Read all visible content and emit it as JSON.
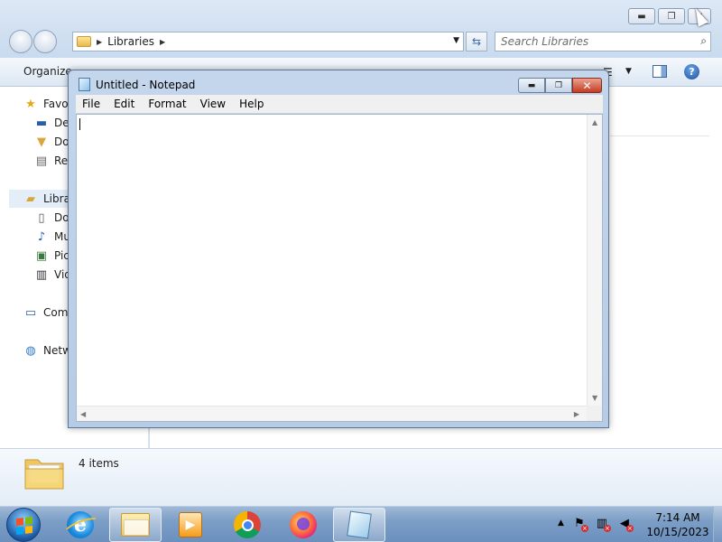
{
  "explorer": {
    "breadcrumb": {
      "items": [
        "Libraries"
      ]
    },
    "search": {
      "placeholder": "Search Libraries"
    },
    "toolbar": {
      "organize_label": "Organize"
    },
    "nav": {
      "favorites": {
        "label": "Favo",
        "icon": "star-icon",
        "children": [
          {
            "label": "Des",
            "icon": "desktop-icon"
          },
          {
            "label": "Dov",
            "icon": "downloads-icon"
          },
          {
            "label": "Rec",
            "icon": "recent-places-icon"
          }
        ]
      },
      "libraries": {
        "label": "Libra",
        "icon": "libraries-icon",
        "children": [
          {
            "label": "Do",
            "icon": "documents-icon"
          },
          {
            "label": "Mu",
            "icon": "music-icon"
          },
          {
            "label": "Pic",
            "icon": "pictures-icon"
          },
          {
            "label": "Vid",
            "icon": "videos-icon"
          }
        ]
      },
      "computer": {
        "label": "Com",
        "icon": "computer-icon"
      },
      "network": {
        "label": "Netw",
        "icon": "network-icon"
      }
    },
    "details": {
      "count_label": "4 items"
    }
  },
  "notepad": {
    "title": "Untitled - Notepad",
    "menu": [
      "File",
      "Edit",
      "Format",
      "View",
      "Help"
    ],
    "content": ""
  },
  "taskbar": {
    "apps": [
      {
        "name": "internet-explorer",
        "active": false
      },
      {
        "name": "windows-explorer",
        "active": true
      },
      {
        "name": "windows-media-player",
        "active": false
      },
      {
        "name": "google-chrome",
        "active": false
      },
      {
        "name": "firefox",
        "active": false
      },
      {
        "name": "notepad",
        "active": true
      }
    ],
    "clock": {
      "time": "7:14 AM",
      "date": "10/15/2023"
    }
  }
}
